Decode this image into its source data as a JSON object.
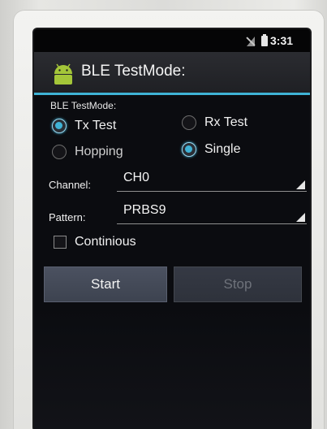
{
  "status_bar": {
    "time": "3:31",
    "signal_icon": "no-sim-icon",
    "battery_icon": "battery-icon"
  },
  "app": {
    "title": "BLE TestMode:",
    "icon": "android-icon",
    "accent_color": "#3fb3d6"
  },
  "form": {
    "section_label": "BLE TestMode:",
    "mode_options": [
      {
        "label": "Tx Test",
        "selected": true
      },
      {
        "label": "Rx Test",
        "selected": false
      }
    ],
    "hop_options": [
      {
        "label": "Hopping",
        "selected": false
      },
      {
        "label": "Single",
        "selected": true
      }
    ],
    "channel": {
      "label": "Channel:",
      "value": "CH0"
    },
    "pattern": {
      "label": "Pattern:",
      "value": "PRBS9"
    },
    "continuous": {
      "label": "Continious",
      "checked": false
    }
  },
  "buttons": {
    "start_label": "Start",
    "stop_label": "Stop",
    "stop_enabled": false
  }
}
